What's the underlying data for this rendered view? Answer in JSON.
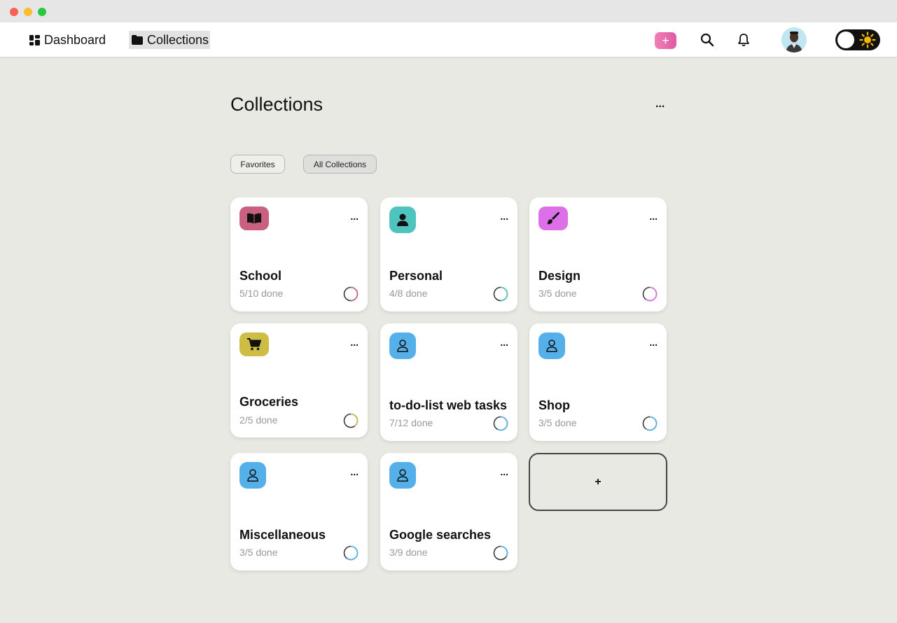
{
  "nav": {
    "dashboard_label": "Dashboard",
    "collections_label": "Collections",
    "add_label": "+"
  },
  "page": {
    "title": "Collections",
    "more": "..."
  },
  "filters": {
    "favorites": "Favorites",
    "all": "All Collections"
  },
  "collections": [
    {
      "name": "School",
      "done": "5/10 done",
      "progress": 0.5,
      "icon": "book-icon",
      "color": "#c9607f"
    },
    {
      "name": "Personal",
      "done": "4/8 done",
      "progress": 0.5,
      "icon": "person-icon",
      "color": "#4fc3bd"
    },
    {
      "name": "Design",
      "done": "3/5 done",
      "progress": 0.6,
      "icon": "brush-icon",
      "color": "#dd70e8"
    },
    {
      "name": "Groceries",
      "done": "2/5 done",
      "progress": 0.4,
      "icon": "cart-icon",
      "color": "#cdbd45"
    },
    {
      "name": "to-do-list web tasks",
      "done": "7/12 done",
      "progress": 0.58,
      "icon": "user-outline-icon",
      "color": "#55b0ea"
    },
    {
      "name": "Shop",
      "done": "3/5 done",
      "progress": 0.6,
      "icon": "user-outline-icon",
      "color": "#55b0ea"
    },
    {
      "name": "Miscellaneous",
      "done": "3/5 done",
      "progress": 0.6,
      "icon": "user-outline-icon",
      "color": "#55b0ea"
    },
    {
      "name": "Google searches",
      "done": "3/9 done",
      "progress": 0.33,
      "icon": "user-outline-icon",
      "color": "#55b0ea"
    }
  ],
  "add_collection_label": "+",
  "card_more": "..."
}
